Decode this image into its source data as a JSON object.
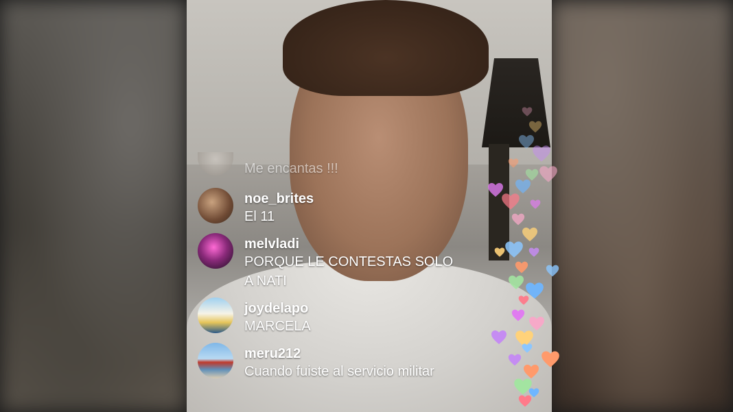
{
  "comments": [
    {
      "username": "",
      "message": "Me encantas !!!",
      "avatar": "avatar-partial"
    },
    {
      "username": "noe_brites",
      "message": "El 11",
      "avatar": "avatar-couple"
    },
    {
      "username": "melvladi",
      "message": "PORQUE LE CONTESTAS SOLO\nA NATI",
      "avatar": "avatar-pink"
    },
    {
      "username": "joydelapo",
      "message": "MARCELA",
      "avatar": "avatar-car"
    },
    {
      "username": "meru212",
      "message": "Cuando fuiste al servicio militar",
      "avatar": "avatar-bridge"
    }
  ],
  "colors": {
    "heart_palette": [
      "#f6a9c8",
      "#ffd27a",
      "#8cc7ff",
      "#c58cf2",
      "#ff9a6b",
      "#a3e4a1",
      "#6fb6ff",
      "#ff7a8a",
      "#e07cf0"
    ]
  }
}
